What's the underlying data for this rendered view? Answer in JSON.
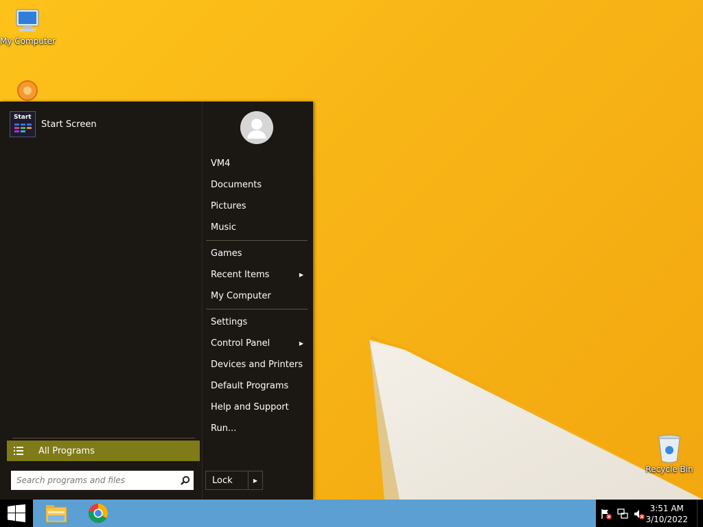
{
  "desktop": {
    "icons": [
      {
        "label": "My Computer"
      },
      {
        "label": "Recycle Bin"
      }
    ]
  },
  "start_menu": {
    "pinned": [
      {
        "label": "Start Screen",
        "tile_text": "Start"
      }
    ],
    "all_programs_label": "All Programs",
    "search": {
      "placeholder": "Search programs and files",
      "value": ""
    },
    "user": {
      "name": "VM4"
    },
    "right_items": [
      {
        "label": "VM4"
      },
      {
        "label": "Documents"
      },
      {
        "label": "Pictures"
      },
      {
        "label": "Music"
      },
      {
        "label": "Games"
      },
      {
        "label": "Recent Items",
        "submenu": true
      },
      {
        "label": "My Computer"
      },
      {
        "label": "Settings"
      },
      {
        "label": "Control Panel",
        "submenu": true
      },
      {
        "label": "Devices and Printers"
      },
      {
        "label": "Default Programs"
      },
      {
        "label": "Help and Support"
      },
      {
        "label": "Run..."
      }
    ],
    "lock_label": "Lock"
  },
  "taskbar": {
    "apps": [
      {
        "icon": "file-explorer-icon"
      },
      {
        "icon": "chrome-icon"
      }
    ],
    "tray_icons": [
      "action-center-flag-icon",
      "network-icon",
      "volume-muted-icon"
    ],
    "clock": {
      "time": "3:51 AM",
      "date": "3/10/2022"
    }
  },
  "colors": {
    "wallpaper": "#f8b516",
    "start_menu_bg": "#1b1712",
    "all_programs_highlight": "#7f7b18",
    "taskbar": "#5c9fd3"
  }
}
